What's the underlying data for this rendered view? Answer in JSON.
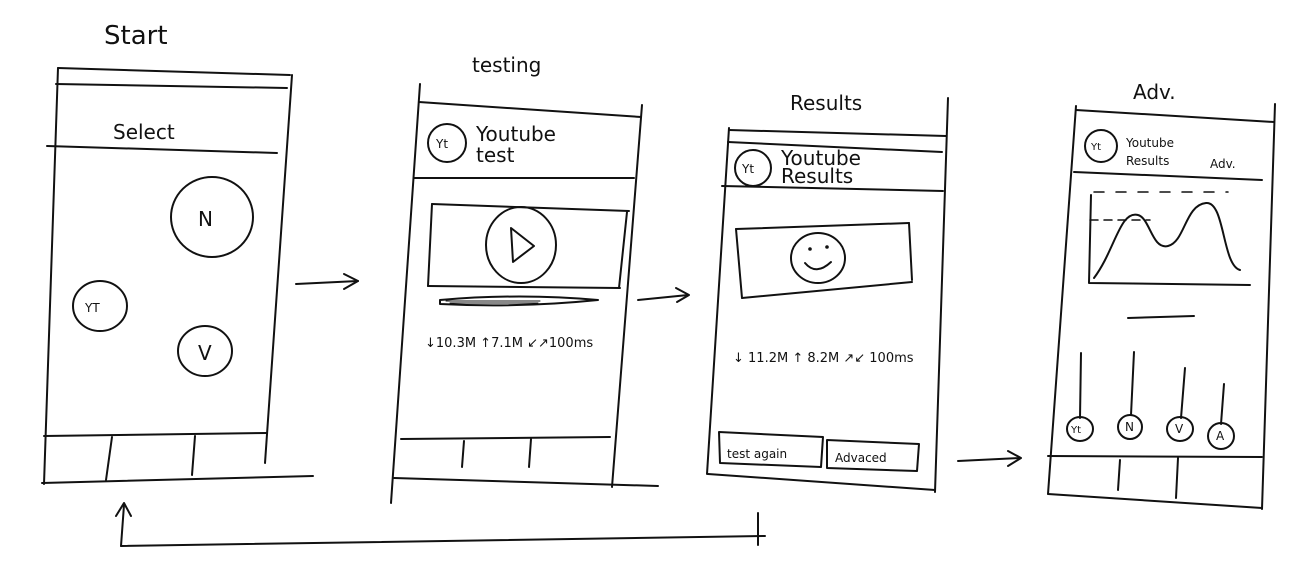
{
  "flow": {
    "screens": [
      {
        "id": "start",
        "caption": "Start",
        "select_header": "Select",
        "options": [
          "N",
          "YT",
          "V"
        ]
      },
      {
        "id": "testing",
        "caption": "testing",
        "header": {
          "logo": "Yt",
          "line1": "Youtube",
          "line2": "test"
        },
        "stats": "↓10.3M ↑7.1M ↙↗100ms"
      },
      {
        "id": "results",
        "caption": "Results",
        "header": {
          "logo": "Yt",
          "line1": "Youtube",
          "line2": "Results"
        },
        "stats": "↓ 11.2M ↑ 8.2M ↗↙ 100ms",
        "buttons": {
          "test_again": "test again",
          "advanced": "Advaced"
        }
      },
      {
        "id": "advanced",
        "caption": "Adv.",
        "header": {
          "logo": "Yt",
          "line1": "Youtube",
          "line2": "Results",
          "tag": "Adv."
        },
        "options": [
          "Yt",
          "N",
          "V",
          "A"
        ]
      }
    ]
  }
}
